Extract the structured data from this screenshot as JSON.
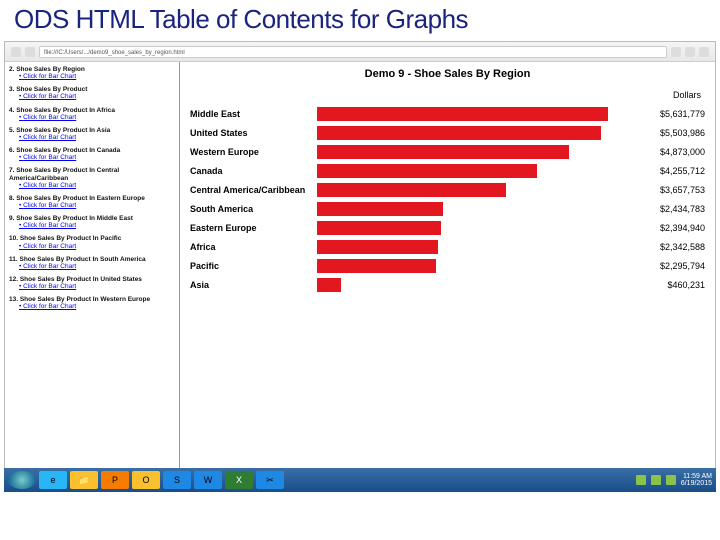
{
  "slide_title": "ODS HTML Table of Contents for Graphs",
  "address_bar": "file:///C:/Users/.../demo9_shoe_sales_by_region.html",
  "toc": [
    {
      "n": "2",
      "title": "Shoe Sales By Region",
      "sub": "Click for Bar Chart"
    },
    {
      "n": "3",
      "title": "Shoe Sales By Product",
      "sub": "Click for Bar Chart"
    },
    {
      "n": "4",
      "title": "Shoe Sales By Product In Africa",
      "sub": "Click for Bar Chart"
    },
    {
      "n": "5",
      "title": "Shoe Sales By Product In Asia",
      "sub": "Click for Bar Chart"
    },
    {
      "n": "6",
      "title": "Shoe Sales By Product In Canada",
      "sub": "Click for Bar Chart"
    },
    {
      "n": "7",
      "title": "Shoe Sales By Product In Central America/Caribbean",
      "sub": "Click for Bar Chart"
    },
    {
      "n": "8",
      "title": "Shoe Sales By Product In Eastern Europe",
      "sub": "Click for Bar Chart"
    },
    {
      "n": "9",
      "title": "Shoe Sales By Product In Middle East",
      "sub": "Click for Bar Chart"
    },
    {
      "n": "10",
      "title": "Shoe Sales By Product In Pacific",
      "sub": "Click for Bar Chart"
    },
    {
      "n": "11",
      "title": "Shoe Sales By Product In South America",
      "sub": "Click for Bar Chart"
    },
    {
      "n": "12",
      "title": "Shoe Sales By Product In United States",
      "sub": "Click for Bar Chart"
    },
    {
      "n": "13",
      "title": "Shoe Sales By Product In Western Europe",
      "sub": "Click for Bar Chart"
    }
  ],
  "chart_data": {
    "type": "bar",
    "orientation": "horizontal",
    "title": "Demo 9 - Shoe Sales By Region",
    "xlabel": "",
    "ylabel": "Dollars",
    "categories": [
      "Middle East",
      "United States",
      "Western Europe",
      "Canada",
      "Central America/Caribbean",
      "South America",
      "Eastern Europe",
      "Africa",
      "Pacific",
      "Asia"
    ],
    "values": [
      5631779,
      5503986,
      4873000,
      4255712,
      3657753,
      2434783,
      2394940,
      2342588,
      2295794,
      460231
    ],
    "value_labels": [
      "$5,631,779",
      "$5,503,986",
      "$4,873,000",
      "$4,255,712",
      "$3,657,753",
      "$2,434,783",
      "$2,394,940",
      "$2,342,588",
      "$2,295,794",
      "$460,231"
    ],
    "xlim": [
      0,
      6000000
    ]
  },
  "taskbar": {
    "apps": [
      "start",
      "ie",
      "explorer",
      "powerpoint",
      "outlook",
      "sas",
      "word",
      "excel",
      "snip"
    ],
    "tray_time": "11:59 AM",
    "tray_date": "6/19/2015"
  }
}
